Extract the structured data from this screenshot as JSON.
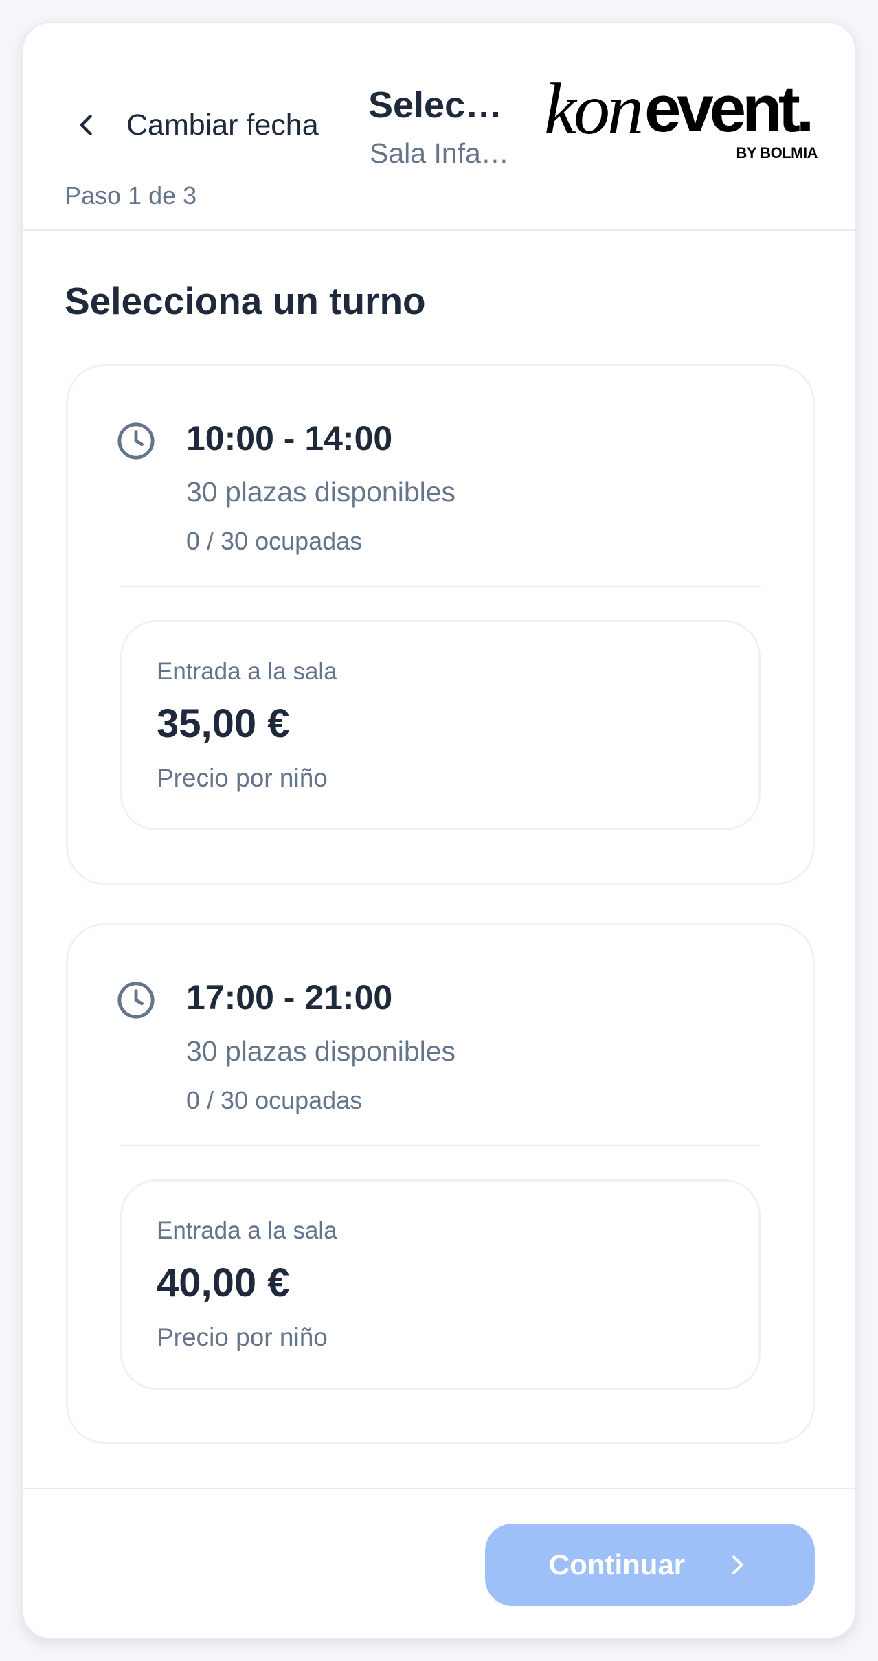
{
  "header": {
    "back_label": "Cambiar fecha",
    "title": "Selecciona un turno",
    "subtitle": "Sala Infantil",
    "step": "Paso 1 de 3",
    "logo": {
      "main": "kon",
      "accent": "event.",
      "by": "BY BOLMIA"
    }
  },
  "main": {
    "section_title": "Selecciona un turno",
    "slots": [
      {
        "time": "10:00 - 14:00",
        "available": "30 plazas disponibles",
        "occupied": "0 / 30 ocupadas",
        "price_label": "Entrada a la sala",
        "price": "35,00 €",
        "price_note": "Precio por niño",
        "icon": "clock-icon"
      },
      {
        "time": "17:00 - 21:00",
        "available": "30 plazas disponibles",
        "occupied": "0 / 30 ocupadas",
        "price_label": "Entrada a la sala",
        "price": "40,00 €",
        "price_note": "Precio por niño",
        "icon": "clock-icon"
      }
    ]
  },
  "footer": {
    "continue_label": "Continuar",
    "continue_color": "#9ec0f9",
    "continue_enabled": false
  },
  "colors": {
    "text_primary": "#1e293b",
    "text_muted": "#64748b",
    "border": "#eef2f5",
    "page_bg": "#f4f6f9"
  }
}
